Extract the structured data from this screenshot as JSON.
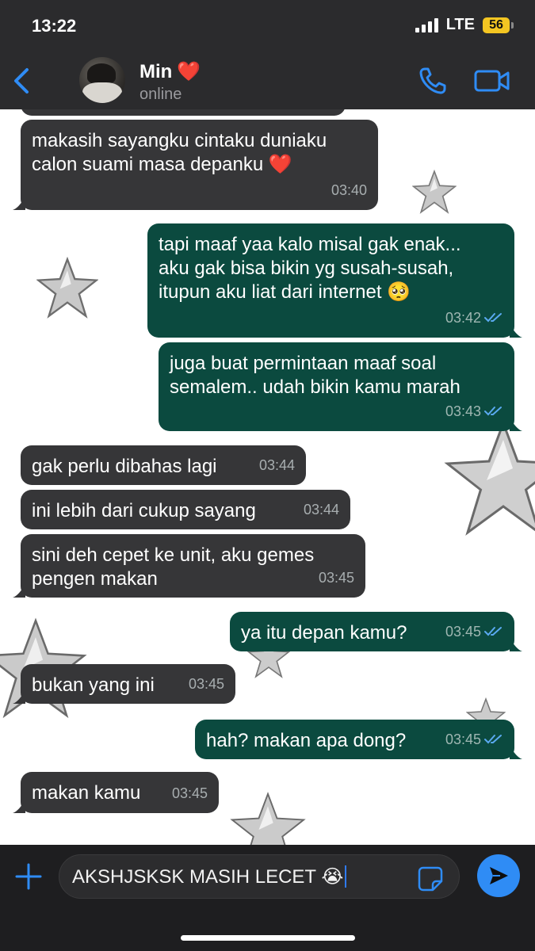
{
  "status_bar": {
    "time": "13:22",
    "network": "LTE",
    "battery": "56"
  },
  "header": {
    "contact_name": "Min",
    "name_emoji": "❤️",
    "contact_status": "online"
  },
  "messages": [
    {
      "direction": "incoming",
      "text": "makasih sayangku cintaku duniaku\ncalon suami masa depanku ❤️",
      "time": "03:40"
    },
    {
      "direction": "outgoing",
      "text": "tapi maaf yaa kalo misal gak enak...\naku gak bisa bikin yg susah-susah,\nitupun aku liat dari internet 🥺",
      "time": "03:42",
      "status": "read"
    },
    {
      "direction": "outgoing",
      "text": "juga buat permintaan maaf soal\nsemalem.. udah bikin kamu marah",
      "time": "03:43",
      "status": "read"
    },
    {
      "direction": "incoming",
      "text": "gak perlu dibahas lagi",
      "time": "03:44"
    },
    {
      "direction": "incoming",
      "text": "ini lebih dari cukup sayang",
      "time": "03:44"
    },
    {
      "direction": "incoming",
      "text": "sini deh cepet ke unit, aku gemes\npengen makan",
      "time": "03:45"
    },
    {
      "direction": "outgoing",
      "text": "ya itu depan kamu?",
      "time": "03:45",
      "status": "read"
    },
    {
      "direction": "incoming",
      "text": "bukan yang ini",
      "time": "03:45"
    },
    {
      "direction": "outgoing",
      "text": "hah? makan apa dong?",
      "time": "03:45",
      "status": "read"
    },
    {
      "direction": "incoming",
      "text": "makan kamu",
      "time": "03:45"
    }
  ],
  "composer": {
    "value": "AKSHJSKSK MASIH LECET 😭"
  },
  "icons": {
    "back": "chevron-left-icon",
    "call": "phone-icon",
    "video": "video-camera-icon",
    "plus": "plus-icon",
    "sticker": "sticker-icon",
    "send": "send-arrow-icon",
    "read": "double-check-icon"
  },
  "colors": {
    "header_bg": "#2b2b2d",
    "incoming_bubble": "#363638",
    "outgoing_bubble": "#0b4a3f",
    "accent": "#2f8cf5",
    "read_tick": "#5aa9f0",
    "chat_bg": "#ffffff"
  }
}
